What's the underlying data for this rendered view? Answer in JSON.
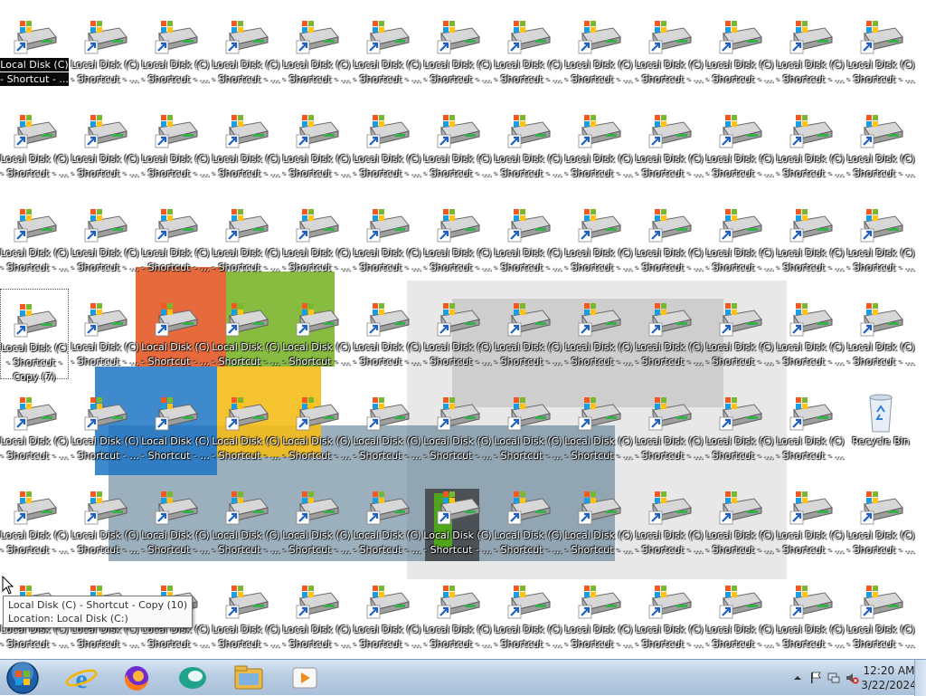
{
  "desktop": {
    "shortcut_label_line1": "Local Disk (C)",
    "shortcut_label_line2": "- Shortcut - ...",
    "selected_label_line2": "- Shortcut -",
    "selected_label_line3": "Copy (7)",
    "recycle_bin_label": "Recycle Bin"
  },
  "tooltip": {
    "line1": "Local Disk (C) - Shortcut - Copy (10)",
    "line2": "Location: Local Disk (C:)"
  },
  "taskbar": {
    "start_icon": "windows-start-orb-icon",
    "pinned": [
      {
        "name": "internet-explorer-icon"
      },
      {
        "name": "firefox-icon"
      },
      {
        "name": "app-teal-icon"
      },
      {
        "name": "file-explorer-icon"
      },
      {
        "name": "media-player-icon"
      }
    ],
    "clock_time": "12:20 AM",
    "clock_date": "3/22/2024"
  },
  "colors": {
    "taskbar": "#b9cde2",
    "text_shadow": "#000000",
    "tooltip_bg": "#fafafa"
  }
}
